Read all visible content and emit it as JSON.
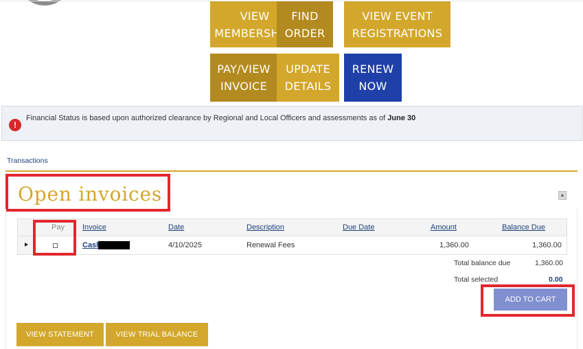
{
  "tiles": {
    "view_membership": [
      "VIEW",
      "MEMBERSHIP"
    ],
    "find_order": [
      "FIND",
      "ORDER"
    ],
    "view_event_registrations": [
      "VIEW EVENT",
      "REGISTRATIONS"
    ],
    "pay_view_invoice": [
      "PAY/VIEW",
      "INVOICE"
    ],
    "update_details": [
      "UPDATE",
      "DETAILS"
    ],
    "renew_now": [
      "RENEW",
      "NOW"
    ]
  },
  "alert": {
    "text": "Financial Status is based upon authorized clearance by Regional and Local Officers and assessments as of ",
    "date": "June 30"
  },
  "tabs": {
    "transactions": "Transactions"
  },
  "section": {
    "title": "Open invoices",
    "collapse_icon": "▲"
  },
  "table": {
    "columns": [
      "Pay",
      "Invoice",
      "Date",
      "Description",
      "Due Date",
      "Amount",
      "Balance Due"
    ],
    "rows": [
      {
        "invoice": "Cash",
        "date": "4/10/2025",
        "description": "Renewal Fees",
        "due_date": "",
        "amount": "1,360.00",
        "balance_due": "1,360.00"
      }
    ]
  },
  "totals": {
    "balance_label": "Total balance due",
    "balance_value": "1,360.00",
    "selected_label": "Total selected",
    "selected_value": "0.00"
  },
  "buttons": {
    "add_to_cart": "ADD TO CART",
    "view_statement": "VIEW STATEMENT",
    "view_trial_balance": "VIEW TRIAL BALANCE"
  },
  "colors": {
    "gold": "#d3a72b",
    "dark_gold": "#b38a1f",
    "blue": "#1e40a8",
    "highlight_red": "#e3262e",
    "cart_button": "#7f8fcf"
  }
}
